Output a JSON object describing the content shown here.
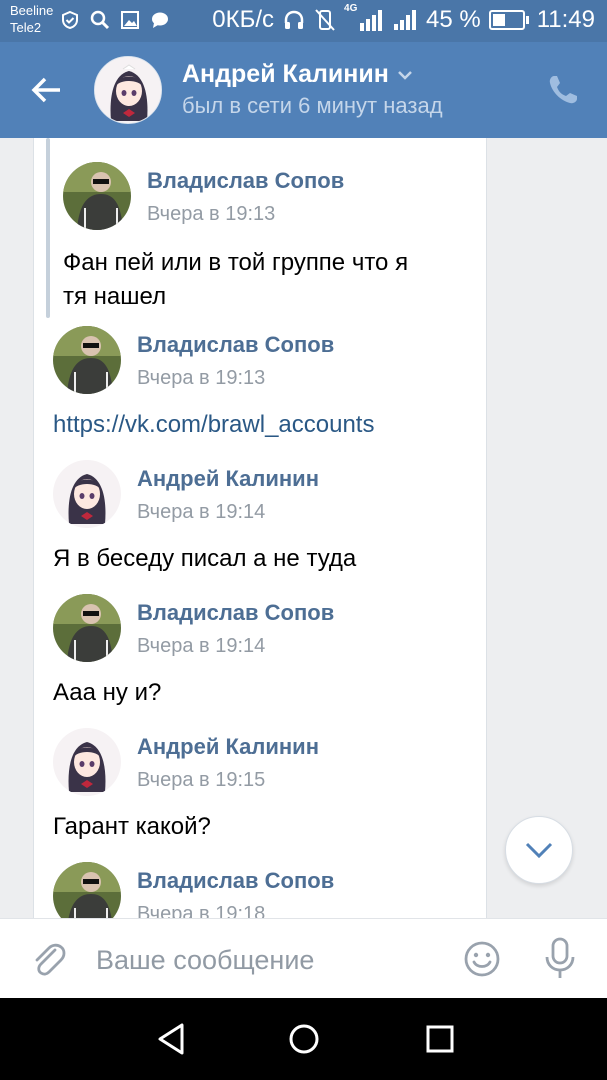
{
  "status_bar": {
    "carrier_1": "Beeline",
    "carrier_2": "Tele2",
    "speed": "0КБ/с",
    "network": "4G",
    "battery_text": "45 %",
    "battery_level": 0.45,
    "time": "11:49"
  },
  "header": {
    "name": "Андрей Калинин",
    "status": "был в сети 6 минут назад"
  },
  "messages": [
    {
      "author": "Владислав Сопов",
      "time": "Вчера в 19:13",
      "text_line1": "Фан пей или в той группе что я",
      "text_line2": "тя нашел",
      "avatar": "photo-avatar"
    },
    {
      "author": "Владислав Сопов",
      "time": "Вчера в 19:13",
      "link": "https://vk.com/brawl_accounts",
      "avatar": "photo-avatar"
    },
    {
      "author": "Андрей Калинин",
      "time": "Вчера в 19:14",
      "text": "Я в беседу писал а не туда",
      "avatar": "anime-avatar"
    },
    {
      "author": "Владислав Сопов",
      "time": "Вчера в 19:14",
      "text": "Ааа ну и?",
      "avatar": "photo-avatar"
    },
    {
      "author": "Андрей Калинин",
      "time": "Вчера в 19:15",
      "text": "Гарант какой?",
      "avatar": "anime-avatar"
    },
    {
      "author": "Владислав Сопов",
      "time": "Вчера в 19:18",
      "avatar": "photo-avatar"
    }
  ],
  "input": {
    "placeholder": "Ваше сообщение"
  },
  "colors": {
    "status_bar": "#4a76a8",
    "header": "#5181b8",
    "author_name": "#4d6e94",
    "link": "#2a5885"
  }
}
